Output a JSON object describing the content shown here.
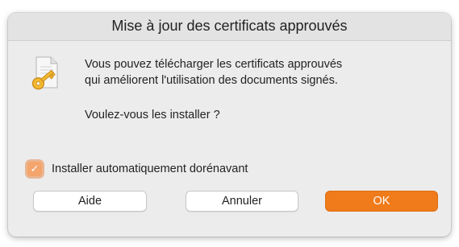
{
  "dialog": {
    "title": "Mise à jour des certificats approuvés",
    "message_line1": "Vous pouvez télécharger les certificats approuvés",
    "message_line2": "qui améliorent l'utilisation des documents signés.",
    "question": "Voulez-vous les installer ?",
    "icon": "certificate-key-icon"
  },
  "checkbox": {
    "label": "Installer automatiquement dorénavant",
    "checked": true
  },
  "buttons": {
    "help_label": "Aide",
    "cancel_label": "Annuler",
    "ok_label": "OK"
  },
  "colors": {
    "accent": "#EF7B1A",
    "dialog_background": "#ECECEC"
  }
}
